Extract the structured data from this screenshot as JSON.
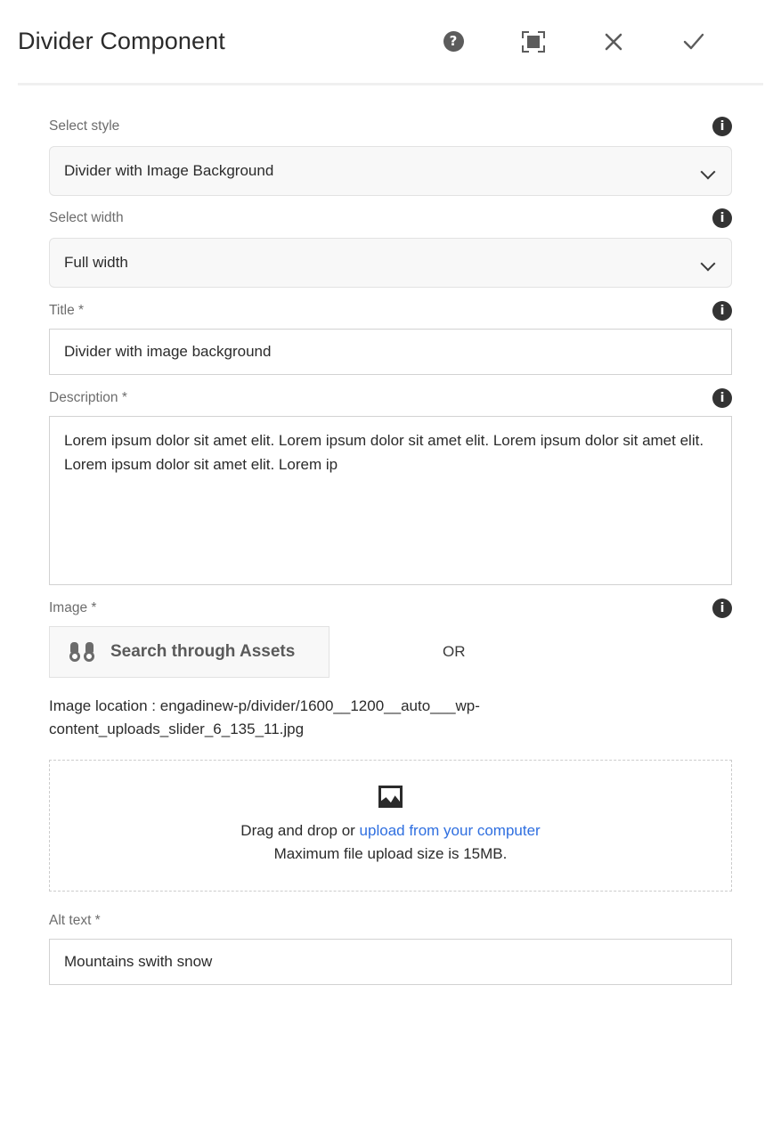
{
  "header": {
    "title": "Divider Component",
    "actions": [
      {
        "name": "help-icon",
        "label": "?"
      },
      {
        "name": "fullscreen-icon",
        "label": ""
      },
      {
        "name": "close-icon",
        "label": ""
      },
      {
        "name": "confirm-icon",
        "label": ""
      }
    ]
  },
  "info_icon_glyph": "i",
  "fields": {
    "select_style": {
      "label": "Select style",
      "value": "Divider with Image Background",
      "info": "i"
    },
    "select_width": {
      "label": "Select width",
      "value": "Full width",
      "info": "i"
    },
    "title": {
      "label": "Title *",
      "value": "Divider with image background",
      "info": "i"
    },
    "description": {
      "label": "Description *",
      "value": "Lorem ipsum dolor sit amet elit. Lorem ipsum dolor sit amet elit. Lorem ipsum dolor sit amet elit. Lorem ipsum dolor sit amet elit. Lorem ip",
      "info": "i"
    },
    "image": {
      "label": "Image *",
      "info": "i",
      "search_button_label": "Search through Assets",
      "search_button_icon": "binoculars-icon",
      "or_text": "OR",
      "location_text": "Image location : engadinew-p/divider/1600__1200__auto___wp-content_uploads_slider_6_135_11.jpg",
      "dropzone": {
        "icon": "picture-icon",
        "line1_prefix": "Drag and drop or ",
        "line1_link": "upload from your computer",
        "line2": "Maximum file upload size is 15MB."
      }
    },
    "alt_text": {
      "label": "Alt text *",
      "value": "Mountains swith snow"
    }
  },
  "colors": {
    "link": "#2f6fe0",
    "label": "#6d6d6d",
    "text": "#2b2b2b",
    "icon": "#5c5c5c",
    "info_badge": "#333333",
    "select_bg": "#f8f8f8",
    "border": "#d2d2d2"
  }
}
